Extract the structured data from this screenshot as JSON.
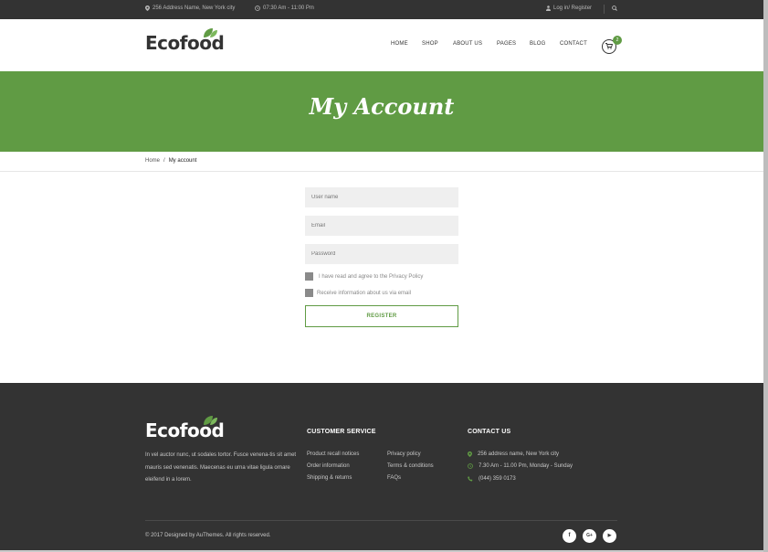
{
  "topbar": {
    "address": "256 Address Name, New York city",
    "hours": "07:30 Am - 11:00 Pm",
    "login": "Log in/ Register"
  },
  "header": {
    "logo": "Ecofood",
    "nav": [
      "HOME",
      "SHOP",
      "ABOUT US",
      "PAGES",
      "BLOG",
      "CONTACT"
    ],
    "cart_count": "2"
  },
  "hero": {
    "title": "My Account"
  },
  "breadcrumb": {
    "home": "Home",
    "separator": "/",
    "current": "My account"
  },
  "form": {
    "username_placeholder": "User name",
    "email_placeholder": "Email",
    "password_placeholder": "Password",
    "agree_label": "I have read and agree to the Privacy Policy",
    "newsletter_label": "Receive information about us via email",
    "register_label": "REGISTER"
  },
  "footer": {
    "logo": "Ecofood",
    "about": "In vel auctor nunc, ut sodales tortor. Fusce venena-tis sit amet mauris sed venenatis. Maecenas eu urna vitae ligula ornare eleifend in a lorem.",
    "customer_service_title": "CUSTOMER SERVICE",
    "links_col1": [
      "Product recall notices",
      "Order information",
      "Shipping & returns"
    ],
    "links_col2": [
      "Privacy policy",
      "Terms & conditions",
      "FAQs"
    ],
    "contact_title": "CONTACT US",
    "contact": {
      "address": "256 address name, New York city",
      "hours": "7.30 Am - 11.00 Pm, Monday - Sunday",
      "phone": "(044) 359 0173"
    },
    "copyright": "© 2017 Designed by AuThemes. All rights reserved.",
    "social": [
      {
        "icon": "facebook-icon",
        "glyph": "f"
      },
      {
        "icon": "google-plus-icon",
        "glyph": "G+"
      },
      {
        "icon": "youtube-icon",
        "glyph": "▶"
      }
    ]
  },
  "colors": {
    "brand_green": "#609b44",
    "dark": "#333333",
    "field_bg": "#efefef"
  }
}
